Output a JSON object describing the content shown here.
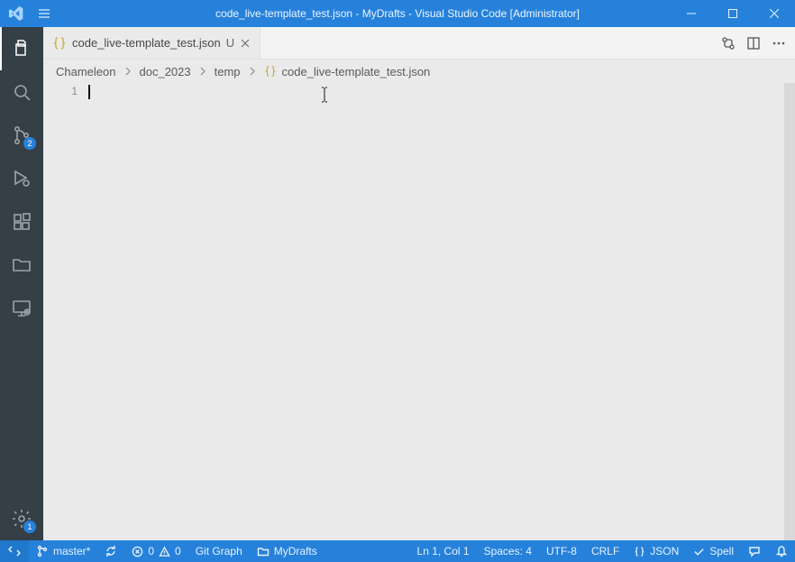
{
  "window": {
    "title": "code_live-template_test.json - MyDrafts - Visual Studio Code [Administrator]"
  },
  "tab": {
    "filename": "code_live-template_test.json",
    "modified_indicator": "U"
  },
  "breadcrumbs": {
    "items": [
      "Chameleon",
      "doc_2023",
      "temp",
      "code_live-template_test.json"
    ]
  },
  "editor": {
    "line_number": "1",
    "content": ""
  },
  "activity": {
    "scm_badge": "2",
    "settings_badge": "1"
  },
  "status": {
    "branch": "master*",
    "errors": "0",
    "warnings": "0",
    "git_graph": "Git Graph",
    "workspace": "MyDrafts",
    "cursor": "Ln 1, Col 1",
    "spaces": "Spaces: 4",
    "encoding": "UTF-8",
    "eol": "CRLF",
    "language": "JSON",
    "spell": "Spell"
  }
}
